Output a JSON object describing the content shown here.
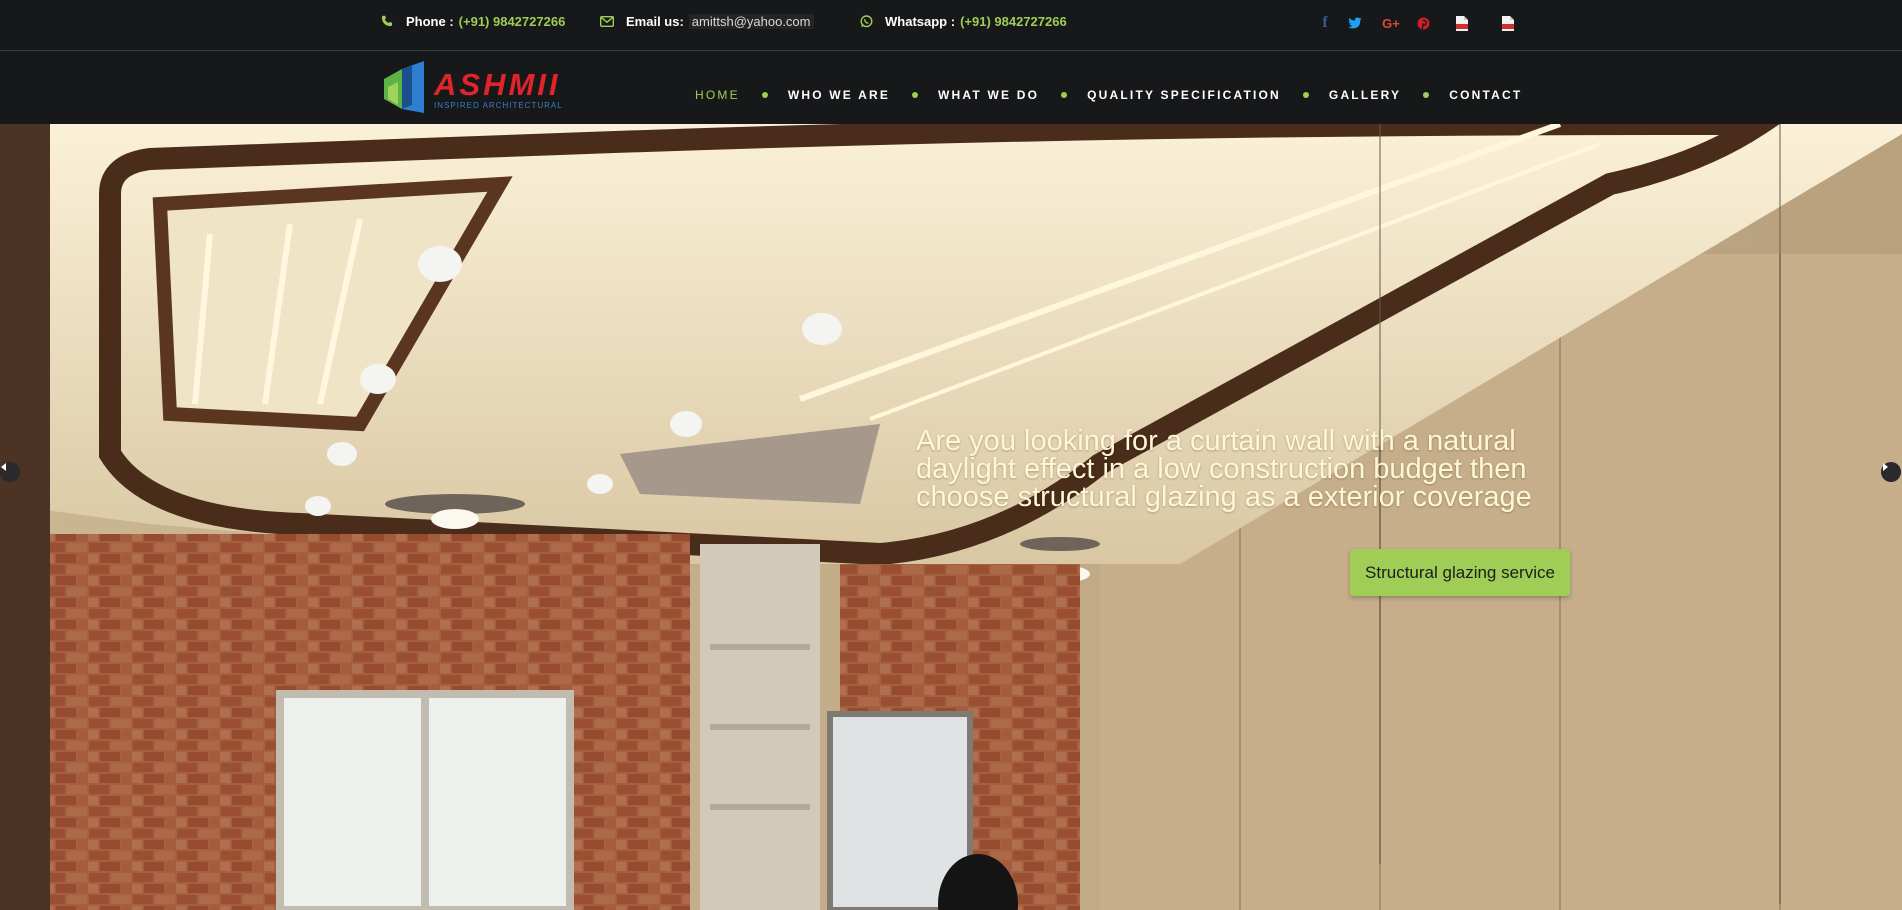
{
  "topbar": {
    "phone_label": "Phone :",
    "phone_value": "(+91) 9842727266",
    "email_label": "Email us:",
    "email_value": "amittsh@yahoo.com",
    "whatsapp_label": "Whatsapp :",
    "whatsapp_value": "(+91) 9842727266",
    "social_icons": [
      "facebook-icon",
      "twitter-icon",
      "google-plus-icon",
      "pinterest-icon",
      "pdf-icon",
      "pdf-icon"
    ]
  },
  "logo": {
    "name": "ASHMII",
    "tagline": "INSPIRED ARCHITECTURAL"
  },
  "nav": {
    "items": [
      {
        "label": "HOME",
        "active": true
      },
      {
        "label": "WHO WE ARE",
        "active": false
      },
      {
        "label": "WHAT WE DO",
        "active": false
      },
      {
        "label": "QUALITY SPECIFICATION",
        "active": false
      },
      {
        "label": "GALLERY",
        "active": false
      },
      {
        "label": "CONTACT",
        "active": false
      }
    ]
  },
  "hero": {
    "lines": [
      "Are you looking for a curtain wall  with a  natural",
      "daylight effect in a low construction budget then",
      "choose structural glazing as a exterior coverage"
    ],
    "button_label": "Structural glazing service"
  },
  "colors": {
    "accent": "#9fcd55",
    "topbar_bg": "#17181a",
    "logo_red": "#e0242b",
    "logo_blue": "#3a7fc0",
    "hero_text": "#fff6d6"
  }
}
